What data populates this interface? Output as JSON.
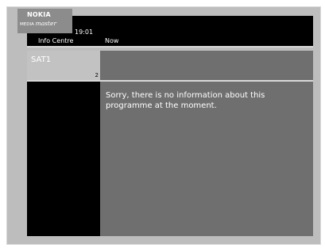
{
  "logo": {
    "brand": "NOKIA",
    "product_prefix": "MEDIA",
    "product_suffix": "master"
  },
  "header": {
    "clock": "19:01",
    "section": "Info Centre",
    "now_label": "Now"
  },
  "channel": {
    "name": "SAT1",
    "number": "2"
  },
  "info": {
    "message": "Sorry, there is no information about this programme at the moment."
  },
  "colors": {
    "frame": "#bdbdbd",
    "panel": "#6f6f6f",
    "channel_box": "#c2c2c2",
    "bar": "#000000",
    "logo_box": "#8c8c8c",
    "text": "#ffffff"
  }
}
